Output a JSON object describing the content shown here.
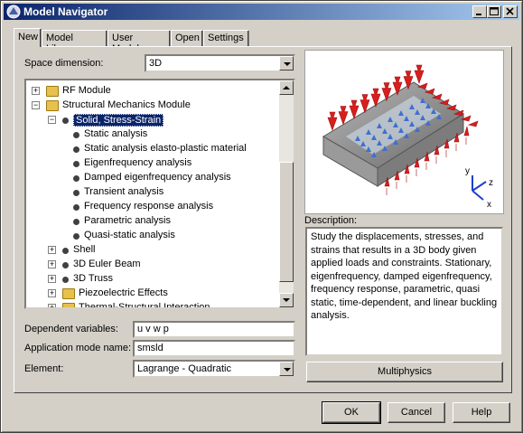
{
  "window": {
    "title": "Model Navigator"
  },
  "tabs": [
    "New",
    "Model Library",
    "User Models",
    "Open",
    "Settings"
  ],
  "space_dimension": {
    "label": "Space dimension:",
    "value": "3D"
  },
  "tree": {
    "items": [
      {
        "label": "RF Module",
        "indent": 0,
        "type": "folder",
        "expander": "+"
      },
      {
        "label": "Structural Mechanics Module",
        "indent": 0,
        "type": "folder",
        "expander": "−"
      },
      {
        "label": "Solid, Stress-Strain",
        "indent": 1,
        "type": "bullet",
        "expander": "−",
        "selected": true
      },
      {
        "label": "Static analysis",
        "indent": 2,
        "type": "bullet"
      },
      {
        "label": "Static analysis elasto-plastic material",
        "indent": 2,
        "type": "bullet"
      },
      {
        "label": "Eigenfrequency analysis",
        "indent": 2,
        "type": "bullet"
      },
      {
        "label": "Damped eigenfrequency analysis",
        "indent": 2,
        "type": "bullet"
      },
      {
        "label": "Transient analysis",
        "indent": 2,
        "type": "bullet"
      },
      {
        "label": "Frequency response analysis",
        "indent": 2,
        "type": "bullet"
      },
      {
        "label": "Parametric analysis",
        "indent": 2,
        "type": "bullet"
      },
      {
        "label": "Quasi-static analysis",
        "indent": 2,
        "type": "bullet"
      },
      {
        "label": "Shell",
        "indent": 1,
        "type": "bullet",
        "expander": "+"
      },
      {
        "label": "3D Euler Beam",
        "indent": 1,
        "type": "bullet",
        "expander": "+"
      },
      {
        "label": "3D Truss",
        "indent": 1,
        "type": "bullet",
        "expander": "+"
      },
      {
        "label": "Piezoelectric Effects",
        "indent": 1,
        "type": "folder",
        "expander": "+"
      },
      {
        "label": "Thermal-Structural Interaction",
        "indent": 1,
        "type": "folder",
        "expander": "+"
      }
    ]
  },
  "dependent_variables": {
    "label": "Dependent variables:",
    "value": "u v w p"
  },
  "application_mode_name": {
    "label": "Application mode name:",
    "value": "smsld"
  },
  "element": {
    "label": "Element:",
    "value": "Lagrange - Quadratic"
  },
  "description": {
    "label": "Description:",
    "text": "Study the displacements, stresses, and strains that results in a 3D body given applied loads and constraints. Stationary, eigenfrequency, damped eigenfrequency, frequency response, parametric, quasi static, time-dependent, and linear buckling analysis."
  },
  "axes": {
    "y": "y",
    "z": "z",
    "x": "x"
  },
  "buttons": {
    "multiphysics": "Multiphysics",
    "ok": "OK",
    "cancel": "Cancel",
    "help": "Help"
  },
  "colors": {
    "titlebar": "#0a246a",
    "selection": "#0a246a",
    "arrows": "#d81e1e"
  }
}
